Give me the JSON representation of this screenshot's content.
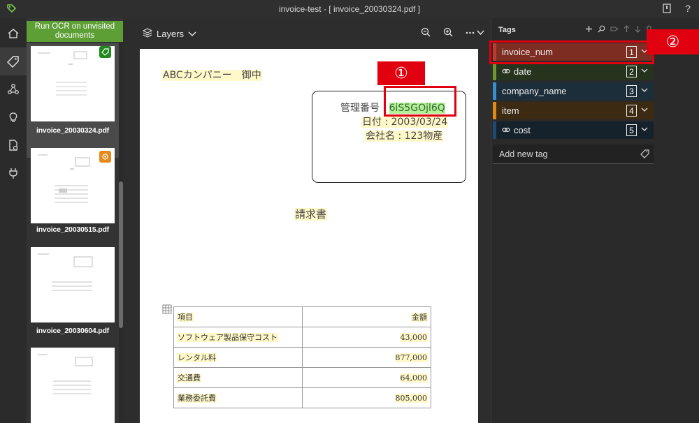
{
  "titlebar": {
    "title": "invoice-test - [ invoice_20030324.pdf ]"
  },
  "rail": {
    "items": [
      "home-icon",
      "tag-icon",
      "connections-icon",
      "lightbulb-icon",
      "document-settings-icon",
      "plug-icon"
    ]
  },
  "sidebar": {
    "ocr_button": "Run OCR on unvisited documents",
    "thumbnails": [
      {
        "label": "invoice_20030324.pdf",
        "badge": "tagged",
        "badge_color": "#1e8a1e"
      },
      {
        "label": "invoice_20030515.pdf",
        "badge": "visited",
        "badge_color": "#e8891b"
      },
      {
        "label": "invoice_20030604.pdf",
        "badge": "",
        "badge_color": ""
      },
      {
        "label": "",
        "badge": "",
        "badge_color": ""
      }
    ]
  },
  "toolbar": {
    "layers_label": "Layers",
    "icons": [
      "zoom-out-icon",
      "zoom-in-icon",
      "more-icon"
    ]
  },
  "document": {
    "addressee": "ABCカンパニー　御中",
    "control_no_label": "管理番号 :",
    "control_no_value": "6iS5GOjl6Q",
    "date_line": "日付 : 2003/03/24",
    "company_line": "会社名 : 123物産",
    "heading": "請求書",
    "table": {
      "header": [
        "項目",
        "金額"
      ],
      "rows": [
        [
          "ソフトウェア製品保守コスト",
          "43,000"
        ],
        [
          "レンタル料",
          "877,000"
        ],
        [
          "交通費",
          "64,000"
        ],
        [
          "業務委託費",
          "805,000"
        ]
      ]
    }
  },
  "annotations": {
    "label_1": "①",
    "label_2": "②",
    "color": "#e1000f"
  },
  "tags": {
    "title": "Tags",
    "tools": [
      "add-icon",
      "search-icon",
      "lock-icon",
      "up-icon",
      "down-icon",
      "delete-icon"
    ],
    "items": [
      {
        "name": "invoice_num",
        "num": "1",
        "color": "#c0392b",
        "bg": "#7d2d22",
        "icon": ""
      },
      {
        "name": "date",
        "num": "2",
        "color": "#6a9a2e",
        "bg": "#26331d",
        "icon": "link-icon"
      },
      {
        "name": "company_name",
        "num": "3",
        "color": "#3a8fd0",
        "bg": "#1d2e3b",
        "icon": ""
      },
      {
        "name": "item",
        "num": "4",
        "color": "#e08a16",
        "bg": "#3d2a12",
        "icon": ""
      },
      {
        "name": "cost",
        "num": "5",
        "color": "#1d4a6e",
        "bg": "#15222c",
        "icon": "link-icon"
      }
    ],
    "add_placeholder": "Add new tag"
  }
}
